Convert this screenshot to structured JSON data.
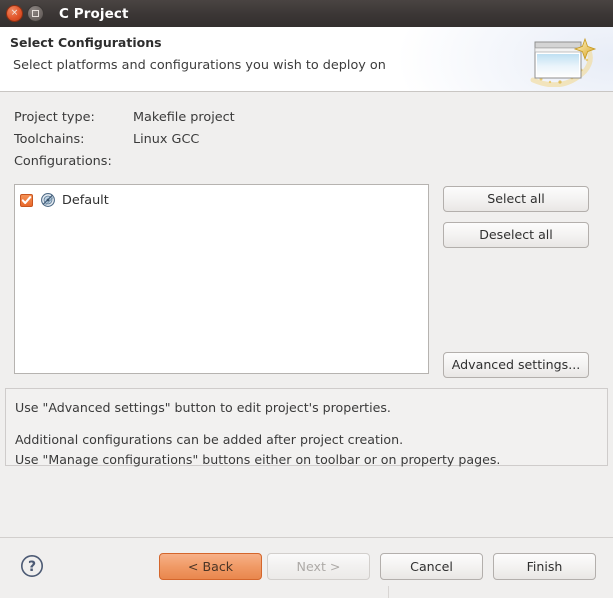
{
  "window": {
    "title": "C Project",
    "controls": {
      "close_label": "×",
      "maximize_label": "□"
    }
  },
  "header": {
    "title": "Select Configurations",
    "description": "Select platforms and configurations you wish to deploy on",
    "icon": "wizard-window-sparkle-icon"
  },
  "main": {
    "info": [
      {
        "label": "Project type:",
        "value": "Makefile project"
      },
      {
        "label": "Toolchains:",
        "value": "Linux GCC"
      },
      {
        "label": "Configurations:",
        "value": ""
      }
    ],
    "configurations": [
      {
        "label": "Default",
        "checked": true,
        "icon": "configuration-icon"
      }
    ],
    "side_buttons": {
      "select_all": "Select all",
      "deselect_all": "Deselect all",
      "advanced_settings": "Advanced settings..."
    },
    "description_panel": {
      "line1": "Use \"Advanced settings\" button to edit project's properties.",
      "line2": "Additional configurations can be added after project creation.",
      "line3": "Use \"Manage configurations\" buttons either on toolbar or on property pages."
    }
  },
  "footer": {
    "help_icon": "help-question-icon",
    "back": "< Back",
    "next": "Next >",
    "cancel": "Cancel",
    "finish": "Finish"
  },
  "colors": {
    "accent_orange": "#e9874d",
    "titlebar": "#3b3635",
    "body_bg": "#f0efee",
    "checkbox_orange": "#e9692c"
  }
}
